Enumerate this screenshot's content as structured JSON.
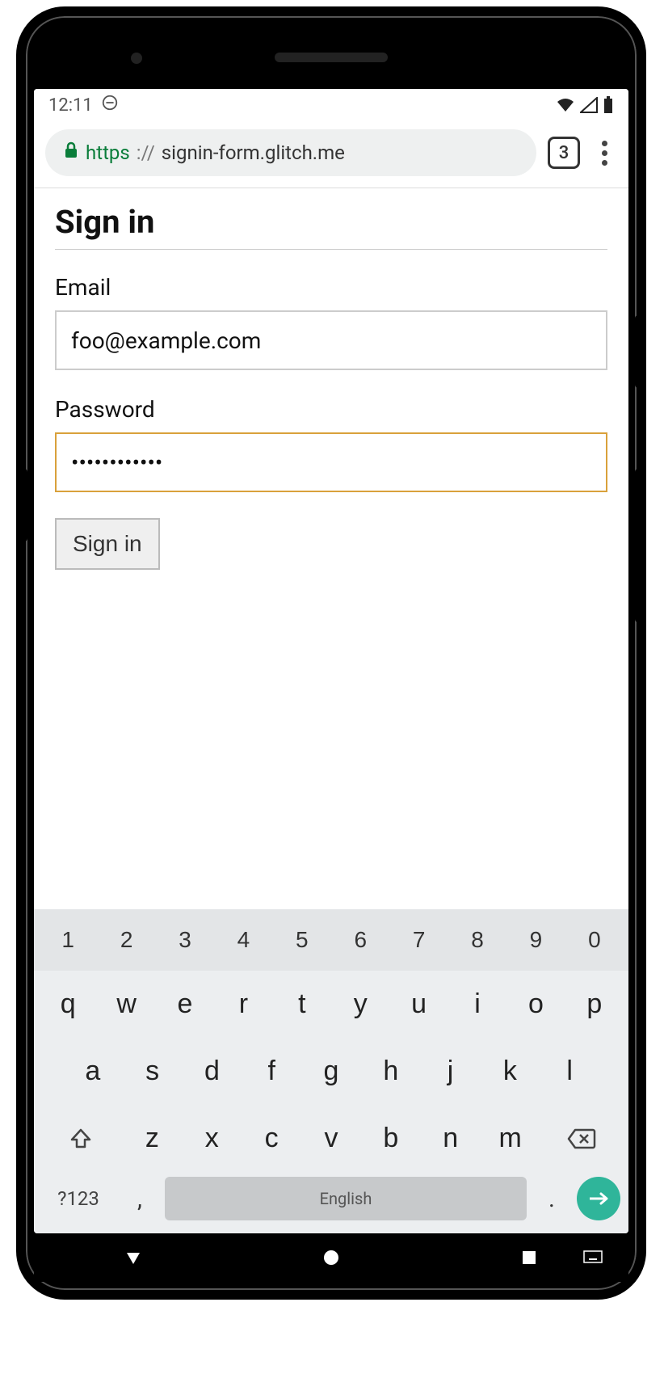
{
  "status": {
    "time": "12:11",
    "icons": [
      "dnd-icon",
      "wifi-icon",
      "cell-icon",
      "battery-icon"
    ]
  },
  "browser": {
    "scheme": "https",
    "sep": "://",
    "host": "signin-form.glitch.me",
    "tab_count": "3"
  },
  "page": {
    "title": "Sign in",
    "email_label": "Email",
    "email_value": "foo@example.com",
    "password_label": "Password",
    "password_value": "••••••••••••",
    "submit_label": "Sign in"
  },
  "keyboard": {
    "numbers": [
      "1",
      "2",
      "3",
      "4",
      "5",
      "6",
      "7",
      "8",
      "9",
      "0"
    ],
    "row1": [
      "q",
      "w",
      "e",
      "r",
      "t",
      "y",
      "u",
      "i",
      "o",
      "p"
    ],
    "row2": [
      "a",
      "s",
      "d",
      "f",
      "g",
      "h",
      "j",
      "k",
      "l"
    ],
    "row3": [
      "z",
      "x",
      "c",
      "v",
      "b",
      "n",
      "m"
    ],
    "symbols_label": "?123",
    "comma": ",",
    "period": ".",
    "space_label": "English"
  }
}
